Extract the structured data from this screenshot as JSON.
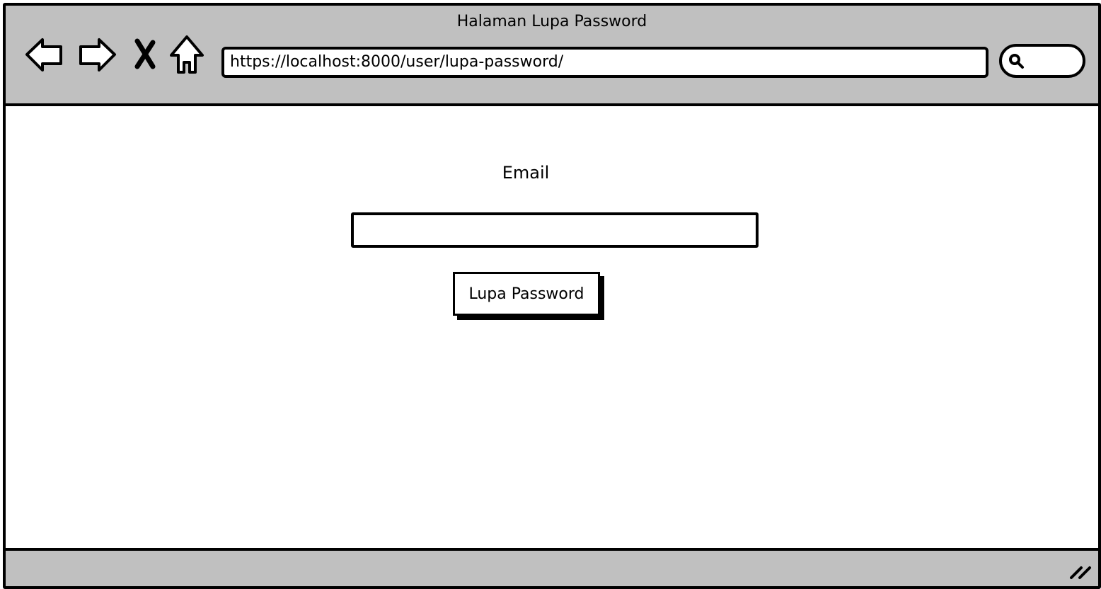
{
  "window": {
    "title": "Halaman Lupa Password"
  },
  "toolbar": {
    "back_icon": "back-arrow-icon",
    "forward_icon": "forward-arrow-icon",
    "stop_icon": "close-icon",
    "home_icon": "home-icon",
    "address": "https://localhost:8000/user/lupa-password/",
    "search_icon": "search-icon",
    "search_value": ""
  },
  "form": {
    "email_label": "Email",
    "email_value": "",
    "submit_label": "Lupa Password"
  },
  "statusbar": {
    "grip_icon": "resize-grip-icon"
  },
  "colors": {
    "chrome": "#c0c0c0",
    "ink": "#000000",
    "content": "#ffffff"
  }
}
